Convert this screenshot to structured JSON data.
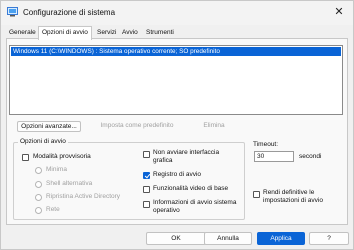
{
  "window": {
    "title": "Configurazione di sistema",
    "close_label": "✕"
  },
  "tabs": [
    "Generale",
    "Opzioni di avvio",
    "Servizi",
    "Avvio",
    "Strumenti"
  ],
  "boot_list": {
    "entries": [
      "Windows 11 (C:\\WINDOWS) : Sistema operativo corrente; SO predefinito"
    ]
  },
  "actions": {
    "advanced": "Opzioni avanzate...",
    "set_default": "Imposta come predefinito",
    "delete": "Elimina"
  },
  "boot_options": {
    "group_label": "Opzioni di avvio",
    "safe_boot": "Modalità provvisoria",
    "minimal": "Minima",
    "alt_shell": "Shell alternativa",
    "ad_repair": "Ripristina Active Directory",
    "network": "Rete",
    "no_gui": "Non avviare interfaccia grafica",
    "boot_log": "Registro di avvio",
    "base_video": "Funzionalità video di base",
    "os_info": "Informazioni di avvio sistema operativo"
  },
  "timeout": {
    "label": "Timeout:",
    "value": "30",
    "unit": "secondi"
  },
  "permanent": {
    "label": "Rendi definitive le impostazioni di avvio"
  },
  "footer": {
    "ok": "OK",
    "cancel": "Annulla",
    "apply": "Applica",
    "help": "?"
  },
  "colors": {
    "accent": "#0a64d6"
  }
}
